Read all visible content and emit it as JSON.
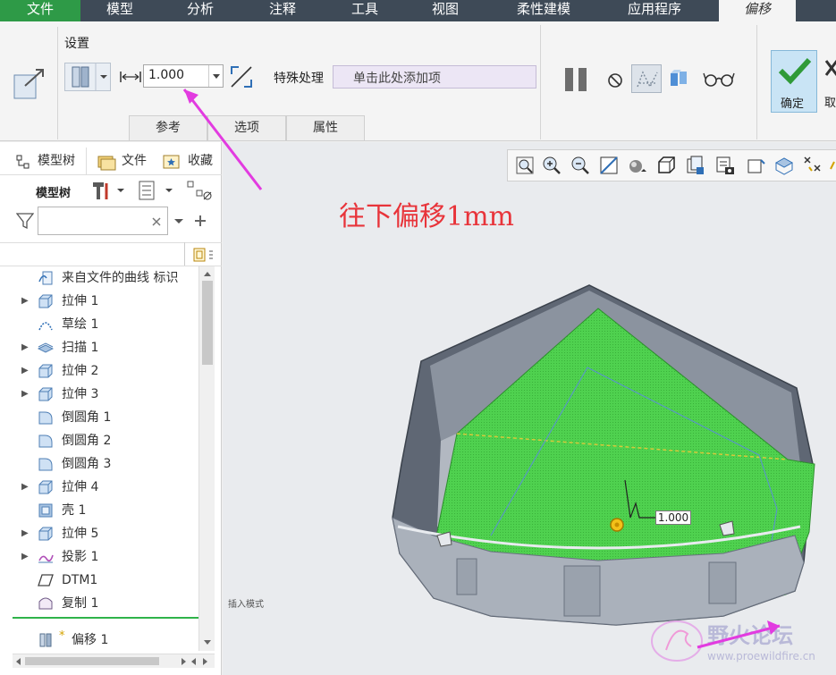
{
  "menu": {
    "file": "文件",
    "model": "模型",
    "analysis": "分析",
    "annotate": "注释",
    "tools": "工具",
    "view": "视图",
    "flexible": "柔性建模",
    "apps": "应用程序",
    "offset": "偏移"
  },
  "ribbon": {
    "settings_label": "设置",
    "distance_value": "1.000",
    "special_label": "特殊处理",
    "special_placeholder": "单击此处添加项",
    "confirm_label": "确定",
    "cancel_label": "取",
    "tabs": [
      "参考",
      "选项",
      "属性"
    ]
  },
  "panel": {
    "tabs": [
      "模型树",
      "文件",
      "收藏"
    ],
    "tree_label": "模型树",
    "search_value": "",
    "items": [
      {
        "label": "来自文件的曲线 标识",
        "icon": "curve-import-icon",
        "expandable": false
      },
      {
        "label": "拉伸 1",
        "icon": "extrude-icon",
        "expandable": true
      },
      {
        "label": "草绘 1",
        "icon": "sketch-icon",
        "expandable": false
      },
      {
        "label": "扫描 1",
        "icon": "sweep-icon",
        "expandable": true
      },
      {
        "label": "拉伸 2",
        "icon": "extrude-icon",
        "expandable": true
      },
      {
        "label": "拉伸 3",
        "icon": "extrude-icon",
        "expandable": true
      },
      {
        "label": "倒圆角 1",
        "icon": "round-icon",
        "expandable": false
      },
      {
        "label": "倒圆角 2",
        "icon": "round-icon",
        "expandable": false
      },
      {
        "label": "倒圆角 3",
        "icon": "round-icon",
        "expandable": false
      },
      {
        "label": "拉伸 4",
        "icon": "extrude-icon",
        "expandable": true
      },
      {
        "label": "壳 1",
        "icon": "shell-icon",
        "expandable": false
      },
      {
        "label": "拉伸 5",
        "icon": "extrude-icon",
        "expandable": true
      },
      {
        "label": "投影 1",
        "icon": "projection-icon",
        "expandable": true
      },
      {
        "label": "DTM1",
        "icon": "datum-plane-icon",
        "expandable": false
      },
      {
        "label": "复制 1",
        "icon": "copy-icon",
        "expandable": false
      }
    ],
    "insert_mark": "*",
    "current_feature": "偏移 1"
  },
  "viewport": {
    "annotation": "往下偏移1mm",
    "dimension_value": "1.000",
    "insert_mode": "插入模式",
    "watermark_title": "野火论坛",
    "watermark_url": "www.proewildfire.cn"
  },
  "colors": {
    "accent_green": "#2e9a47",
    "menubar": "#3e4a57",
    "annotation_red": "#e8343a",
    "highlight_green": "#4fd14f",
    "arrow_magenta": "#e23be0"
  }
}
